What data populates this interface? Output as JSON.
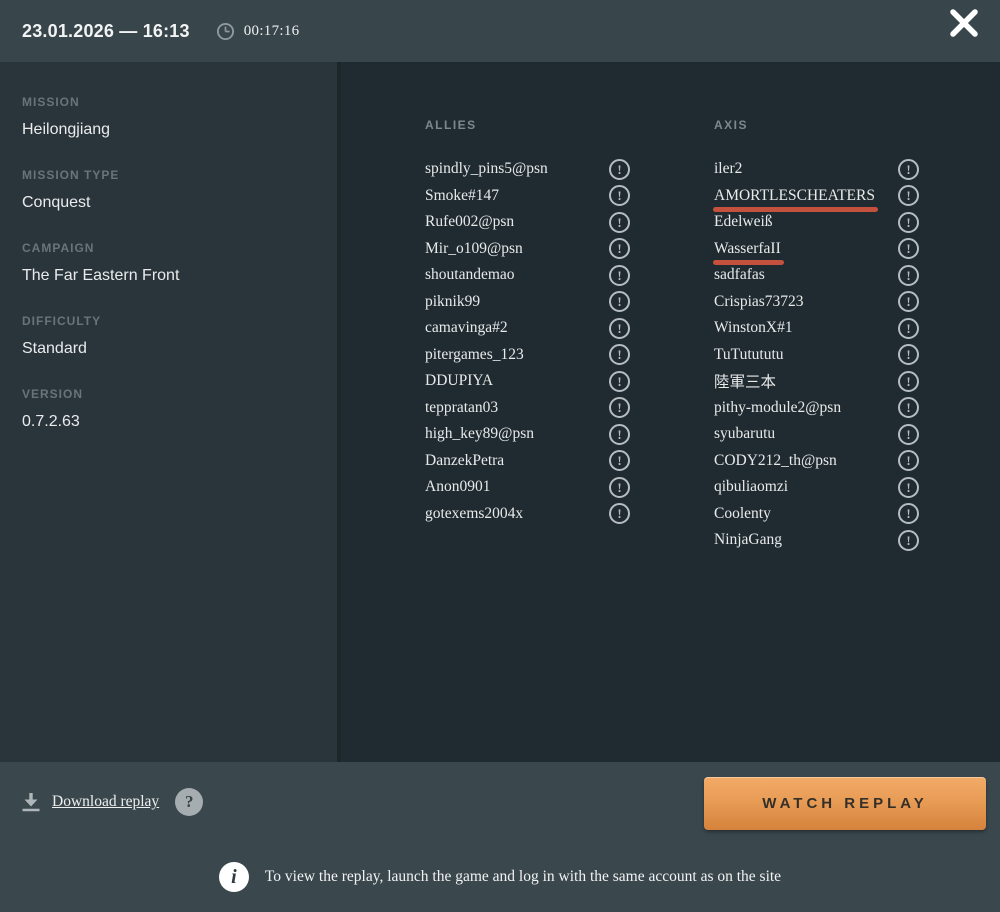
{
  "header": {
    "date": "23.01.2026 — 16:13",
    "duration": "00:17:16"
  },
  "sidebar": {
    "sections": [
      {
        "label": "MISSION",
        "value": "Heilongjiang"
      },
      {
        "label": "MISSION TYPE",
        "value": "Conquest"
      },
      {
        "label": "CAMPAIGN",
        "value": "The Far Eastern Front"
      },
      {
        "label": "DIFFICULTY",
        "value": "Standard"
      },
      {
        "label": "VERSION",
        "value": "0.7.2.63"
      }
    ]
  },
  "teams": {
    "allies": {
      "title": "ALLIES",
      "players": [
        {
          "name": "spindly_pins5@psn",
          "flagged": false
        },
        {
          "name": "Smoke#147",
          "flagged": false
        },
        {
          "name": "Rufe002@psn",
          "flagged": false
        },
        {
          "name": "Mir_o109@psn",
          "flagged": false
        },
        {
          "name": "shoutandemao",
          "flagged": false
        },
        {
          "name": "piknik99",
          "flagged": false
        },
        {
          "name": "camavinga#2",
          "flagged": false
        },
        {
          "name": "pitergames_123",
          "flagged": false
        },
        {
          "name": "DDUPIYA",
          "flagged": false
        },
        {
          "name": "teppratan03",
          "flagged": false
        },
        {
          "name": "high_key89@psn",
          "flagged": false
        },
        {
          "name": "DanzekPetra",
          "flagged": false
        },
        {
          "name": "Anon0901",
          "flagged": false
        },
        {
          "name": "gotexems2004x",
          "flagged": false
        }
      ]
    },
    "axis": {
      "title": "AXIS",
      "players": [
        {
          "name": "iler2",
          "flagged": false
        },
        {
          "name": "AMORTLESCHEATERS",
          "flagged": true
        },
        {
          "name": "Edelweiß",
          "flagged": false
        },
        {
          "name": "WasserfaII",
          "flagged": true
        },
        {
          "name": "sadfafas",
          "flagged": false
        },
        {
          "name": "Crispias73723",
          "flagged": false
        },
        {
          "name": "WinstonX#1",
          "flagged": false
        },
        {
          "name": "TuTutututu",
          "flagged": false
        },
        {
          "name": "陸軍三本",
          "flagged": false
        },
        {
          "name": "pithy-module2@psn",
          "flagged": false
        },
        {
          "name": "syubarutu",
          "flagged": false
        },
        {
          "name": "CODY212_th@psn",
          "flagged": false
        },
        {
          "name": "qibuliaomzi",
          "flagged": false
        },
        {
          "name": "Coolenty",
          "flagged": false
        },
        {
          "name": "NinjaGang",
          "flagged": false
        }
      ]
    }
  },
  "icons": {
    "exclamation": "!",
    "question": "?",
    "info": "i"
  },
  "footer": {
    "download_label": "Download replay",
    "watch_button_label": "WATCH REPLAY",
    "info_text": "To view the replay, launch the game and log in with the same account as on the site"
  },
  "colors": {
    "accent_orange": "#e89c56",
    "flag_red": "#c4503e",
    "topbar_bg": "#38454b",
    "sidebar_bg": "#2a353b",
    "main_bg": "#202b31",
    "footer_bg": "#3a474d"
  }
}
